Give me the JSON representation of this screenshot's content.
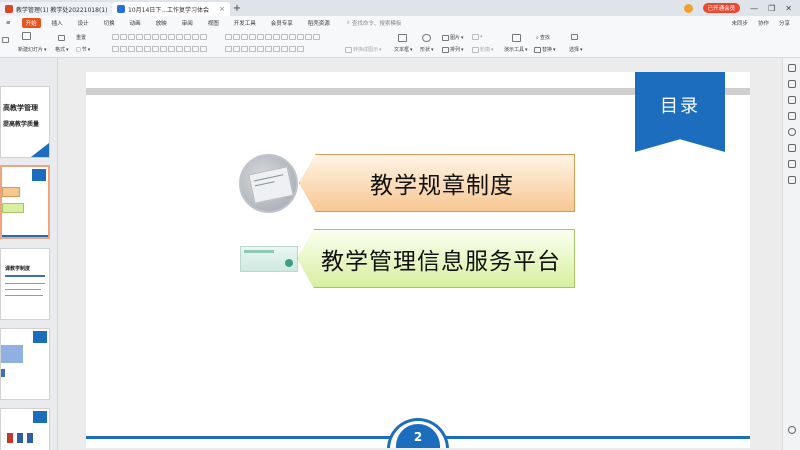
{
  "tabs": [
    {
      "label": "教学管理(1) 教学处20221018(1)",
      "color": "#d9482b"
    },
    {
      "label": "10月14日下...工作复学习体会",
      "color": "#2a6fd6"
    }
  ],
  "titlebar": {
    "vip_label": "已开通会员",
    "cloud_label": "未同步"
  },
  "menu": {
    "items": [
      "开始",
      "插入",
      "设计",
      "切换",
      "动画",
      "放映",
      "审阅",
      "视图",
      "开发工具",
      "会员专享",
      "稻壳资源"
    ],
    "active_index": 0,
    "search_placeholder": "查找命令、搜索模板",
    "right": [
      "未同步",
      "协作",
      "分享"
    ]
  },
  "toolbar": {
    "paste": "粘贴",
    "new_slide": "新建幻灯片",
    "format": "格式",
    "reset": "重置",
    "section": "节",
    "textbox": "文本框",
    "shape": "形状",
    "arrange": "排列",
    "picture": "图片",
    "outline": "轮廓",
    "presenter": "演示工具",
    "replace": "替换",
    "find": "查找",
    "select": "选择",
    "convert": "转换成图示"
  },
  "thumbnails": {
    "t1_line1": "高教学管理",
    "t1_line2": "提高教学质量",
    "t3_title": "课教学制度"
  },
  "slide": {
    "ribbon_title": "目录",
    "item1": "教学规章制度",
    "item2": "教学管理信息服务平台",
    "page_number": "2"
  }
}
